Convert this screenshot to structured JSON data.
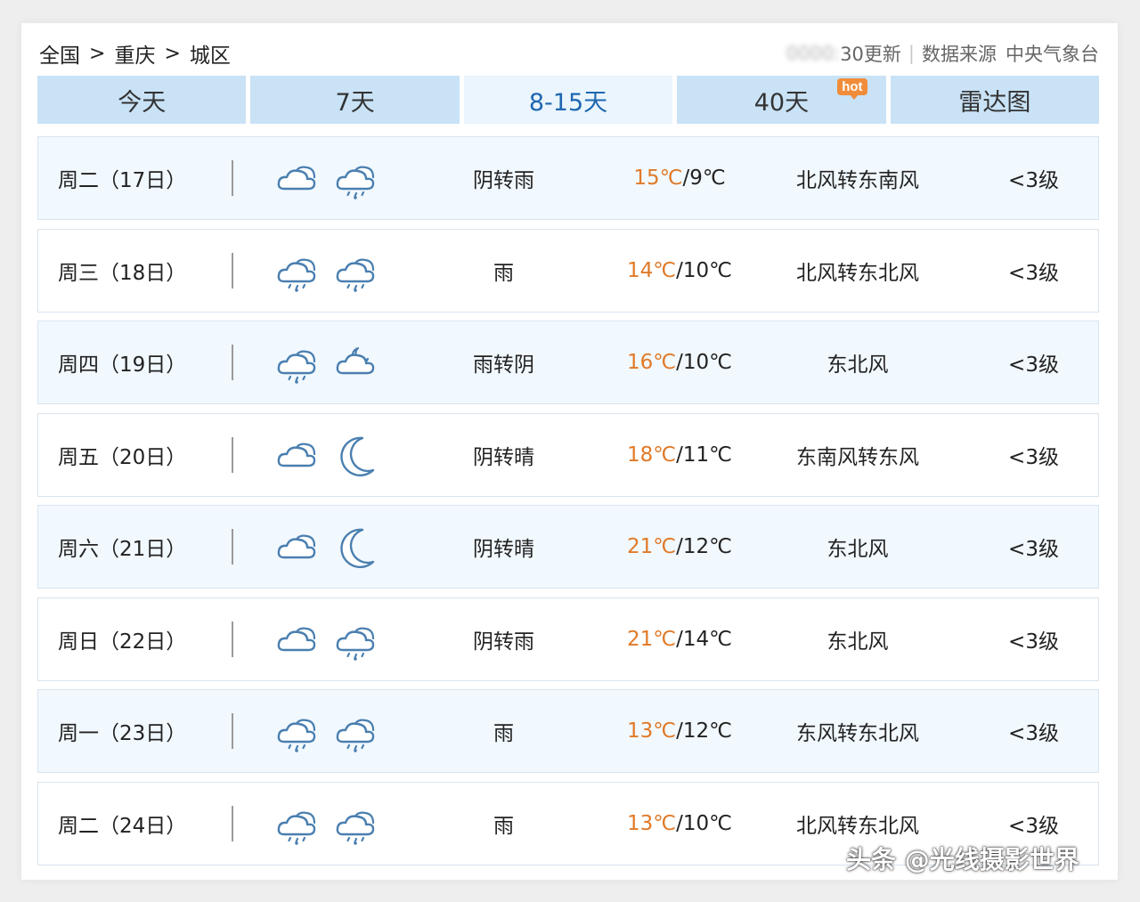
{
  "breadcrumb": [
    "全国",
    "重庆",
    "城区"
  ],
  "breadcrumb_separator": ">",
  "update": {
    "time_text": "30更新",
    "source_label": "数据来源",
    "source_name": "中央气象台"
  },
  "tabs": [
    {
      "label": "今天"
    },
    {
      "label": "7天"
    },
    {
      "label": "8-15天",
      "active": true
    },
    {
      "label": "40天",
      "badge": "hot"
    },
    {
      "label": "雷达图"
    }
  ],
  "forecast": [
    {
      "day": "周二（17日）",
      "icons": [
        "cloudy-icon",
        "rain-icon"
      ],
      "desc": "阴转雨",
      "high": "15℃",
      "low": "9℃",
      "wind": "北风转东南风",
      "level": "<3级"
    },
    {
      "day": "周三（18日）",
      "icons": [
        "rain-icon",
        "rain-icon"
      ],
      "desc": "雨",
      "high": "14℃",
      "low": "10℃",
      "wind": "北风转东北风",
      "level": "<3级"
    },
    {
      "day": "周四（19日）",
      "icons": [
        "rain-icon",
        "cloudy-night-icon"
      ],
      "desc": "雨转阴",
      "high": "16℃",
      "low": "10℃",
      "wind": "东北风",
      "level": "<3级"
    },
    {
      "day": "周五（20日）",
      "icons": [
        "cloudy-icon",
        "moon-icon"
      ],
      "desc": "阴转晴",
      "high": "18℃",
      "low": "11℃",
      "wind": "东南风转东风",
      "level": "<3级"
    },
    {
      "day": "周六（21日）",
      "icons": [
        "cloudy-icon",
        "moon-icon"
      ],
      "desc": "阴转晴",
      "high": "21℃",
      "low": "12℃",
      "wind": "东北风",
      "level": "<3级"
    },
    {
      "day": "周日（22日）",
      "icons": [
        "cloudy-icon",
        "rain-icon"
      ],
      "desc": "阴转雨",
      "high": "21℃",
      "low": "14℃",
      "wind": "东北风",
      "level": "<3级"
    },
    {
      "day": "周一（23日）",
      "icons": [
        "rain-icon",
        "rain-icon"
      ],
      "desc": "雨",
      "high": "13℃",
      "low": "12℃",
      "wind": "东风转东北风",
      "level": "<3级"
    },
    {
      "day": "周二（24日）",
      "icons": [
        "rain-icon",
        "rain-icon"
      ],
      "desc": "雨",
      "high": "13℃",
      "low": "10℃",
      "wind": "北风转东北风",
      "level": "<3级"
    }
  ],
  "watermark": "头条 @光线摄影世界",
  "colors": {
    "tab_bg": "#c9e2f6",
    "tab_active_bg": "#eaf5fd",
    "tab_active_text": "#1e67b0",
    "high_temp": "#e07a28",
    "row_alt_bg": "#f1f8fe",
    "icon_stroke": "#4a7fb0",
    "hot_badge": "#f08c3a"
  }
}
